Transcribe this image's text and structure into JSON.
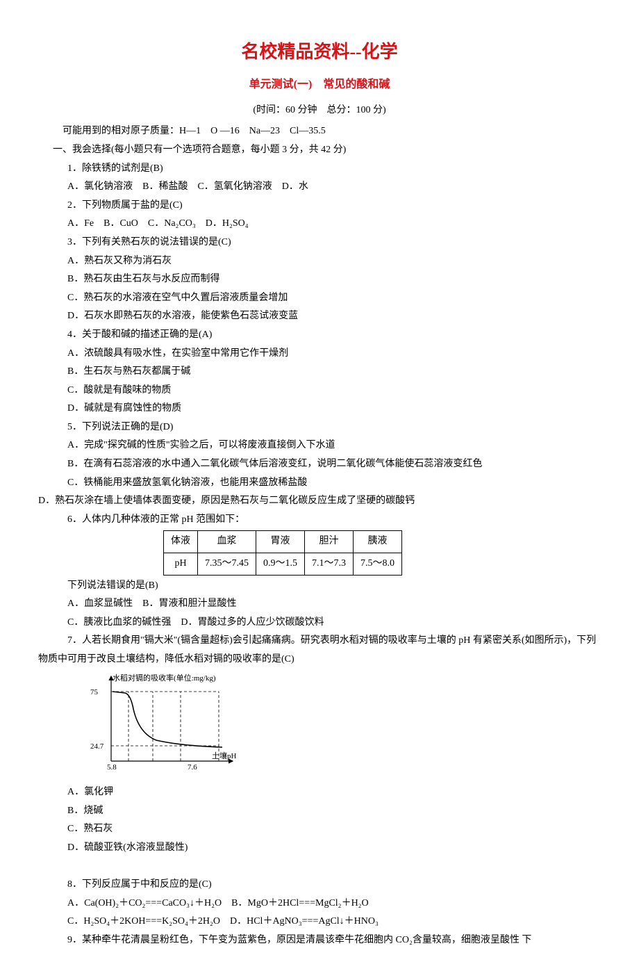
{
  "title_main": "名校精品资料--化学",
  "title_sub": "单元测试(一)　常见的酸和碱",
  "meta": "(时间：60 分钟　总分：100 分)",
  "atomic_mass": "　可能用到的相对原子质量：H—1　O —16　Na—23　Cl—35.5",
  "section1": "一、我会选择(每小题只有一个选项符合题意，每小题 3 分，共 42 分)",
  "q1": {
    "stem": "1．除铁锈的试剂是(B)",
    "a": "A．氯化钠溶液　B．稀盐酸　C．氢氧化钠溶液　D．水"
  },
  "q2": {
    "stem": "2．下列物质属于盐的是(C)",
    "a": "A．Fe　B．CuO　C．Na₂CO₃　D．H₂SO₄"
  },
  "q3": {
    "stem": "3．下列有关熟石灰的说法错误的是(C)",
    "a": "A．熟石灰又称为消石灰",
    "b": "B．熟石灰由生石灰与水反应而制得",
    "c": "C．熟石灰的水溶液在空气中久置后溶液质量会增加",
    "d": "D．石灰水即熟石灰的水溶液，能使紫色石蕊试液变蓝"
  },
  "q4": {
    "stem": "4．关于酸和碱的描述正确的是(A)",
    "a": "A．浓硫酸具有吸水性，在实验室中常用它作干燥剂",
    "b": "B．生石灰与熟石灰都属于碱",
    "c": "C．酸就是有酸味的物质",
    "d": "D．碱就是有腐蚀性的物质"
  },
  "q5": {
    "stem": "5．下列说法正确的是(D)",
    "a": "A．完成\"探究碱的性质\"实验之后，可以将废液直接倒入下水道",
    "b": "B．在滴有石蕊溶液的水中通入二氧化碳气体后溶液变红，说明二氧化碳气体能使石蕊溶液变红色",
    "c": "C．铁桶能用来盛放氢氧化钠溶液，也能用来盛放稀盐酸",
    "d": "D．熟石灰涂在墙上使墙体表面变硬，原因是熟石灰与二氧化碳反应生成了坚硬的碳酸钙"
  },
  "q6": {
    "stem": "6．人体内几种体液的正常 pH 范围如下：",
    "table_h": [
      "体液",
      "血浆",
      "胃液",
      "胆汁",
      "胰液"
    ],
    "table_r": [
      "pH",
      "7.35～7.45",
      "0.9～1.5",
      "7.1～7.3",
      "7.5～8.0"
    ],
    "after": "下列说法错误的是(B)",
    "a": "A．血浆显碱性　B．胃液和胆汁显酸性",
    "b": "C．胰液比血浆的碱性强　D．胃酸过多的人应少饮碳酸饮料"
  },
  "q7": {
    "stem": "7．人若长期食用\"镉大米\"(镉含量超标)会引起痛痛病。研究表明水稻对镉的吸收率与土壤的 pH 有紧密关系(如图所示)，下列物质中可用于改良土壤结构，降低水稻对镉的吸收率的是(C)",
    "a": "A．氯化钾",
    "b": "B．烧碱",
    "c": "C．熟石灰",
    "d": "D．硫酸亚铁(水溶液显酸性)"
  },
  "q8": {
    "stem": "8．下列反应属于中和反应的是(C)",
    "a": "A．Ca(OH)₂＋CO₂===CaCO₃↓＋H₂O　B．MgO＋2HCl===MgCl₂＋H₂O",
    "b": "C．H₂SO₄＋2KOH===K₂SO₄＋2H₂O　D．HCl＋AgNO₃===AgCl↓＋HNO₃"
  },
  "q9": {
    "stem": "9．某种牵牛花清晨呈粉红色，下午变为蓝紫色，原因是清晨该牵牛花细胞内 CO₂含量较高，细胞液呈酸性 下"
  },
  "chart_data": {
    "type": "line",
    "title": "",
    "xlabel": "土壤pH",
    "ylabel": "水稻对镉的吸收率(单位:mg/kg)",
    "x": [
      5.8,
      6.0,
      6.3,
      6.7,
      7.2,
      7.6
    ],
    "y": [
      75.0,
      72.0,
      45.0,
      30.0,
      26.0,
      24.7
    ],
    "xlim": [
      5.8,
      7.6
    ],
    "ylim": [
      0,
      80
    ],
    "yticks": [
      24.7,
      75.0
    ],
    "xticks": [
      5.8,
      7.6
    ]
  }
}
